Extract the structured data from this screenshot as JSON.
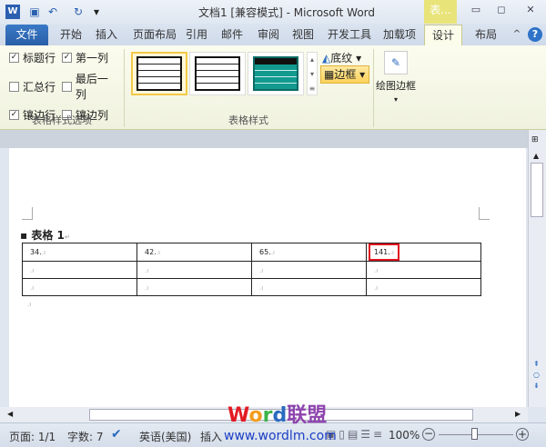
{
  "title_bar": {
    "title": "文档1 [兼容模式] - Microsoft Word",
    "context_tab": "表...",
    "window_buttons": [
      "minimize-icon",
      "restore-icon",
      "close-icon"
    ]
  },
  "tabs": [
    "文件",
    "开始",
    "插入",
    "页面布局",
    "引用",
    "邮件",
    "审阅",
    "视图",
    "开发工具",
    "加载项",
    "设计",
    "布局"
  ],
  "active_tab": "设计",
  "ribbon": {
    "table_style_options": {
      "label": "表格样式选项",
      "options": [
        {
          "label": "标题行",
          "checked": true
        },
        {
          "label": "第一列",
          "checked": true
        },
        {
          "label": "汇总行",
          "checked": false
        },
        {
          "label": "最后一列",
          "checked": false
        },
        {
          "label": "镶边行",
          "checked": true
        },
        {
          "label": "镶边列",
          "checked": false
        }
      ]
    },
    "table_styles": {
      "label": "表格样式",
      "shading": "底纹",
      "borders": "边框"
    },
    "draw_borders": {
      "label": "绘图边框"
    }
  },
  "document": {
    "caption": "表格 1",
    "table": [
      [
        "34.",
        "42.",
        "65.",
        "141."
      ],
      [
        "",
        "",
        "",
        ""
      ],
      [
        "",
        "",
        "",
        ""
      ]
    ],
    "highlight": {
      "row": 0,
      "col": 3,
      "color": "#e0141e"
    }
  },
  "status": {
    "page": "页面: 1/1",
    "words": "字数: 7",
    "language": "英语(美国)",
    "mode": "插入",
    "zoom": "100%",
    "zoom_level": 100
  },
  "watermark": {
    "brand": "Word联盟",
    "url": "www.wordlm.com"
  }
}
